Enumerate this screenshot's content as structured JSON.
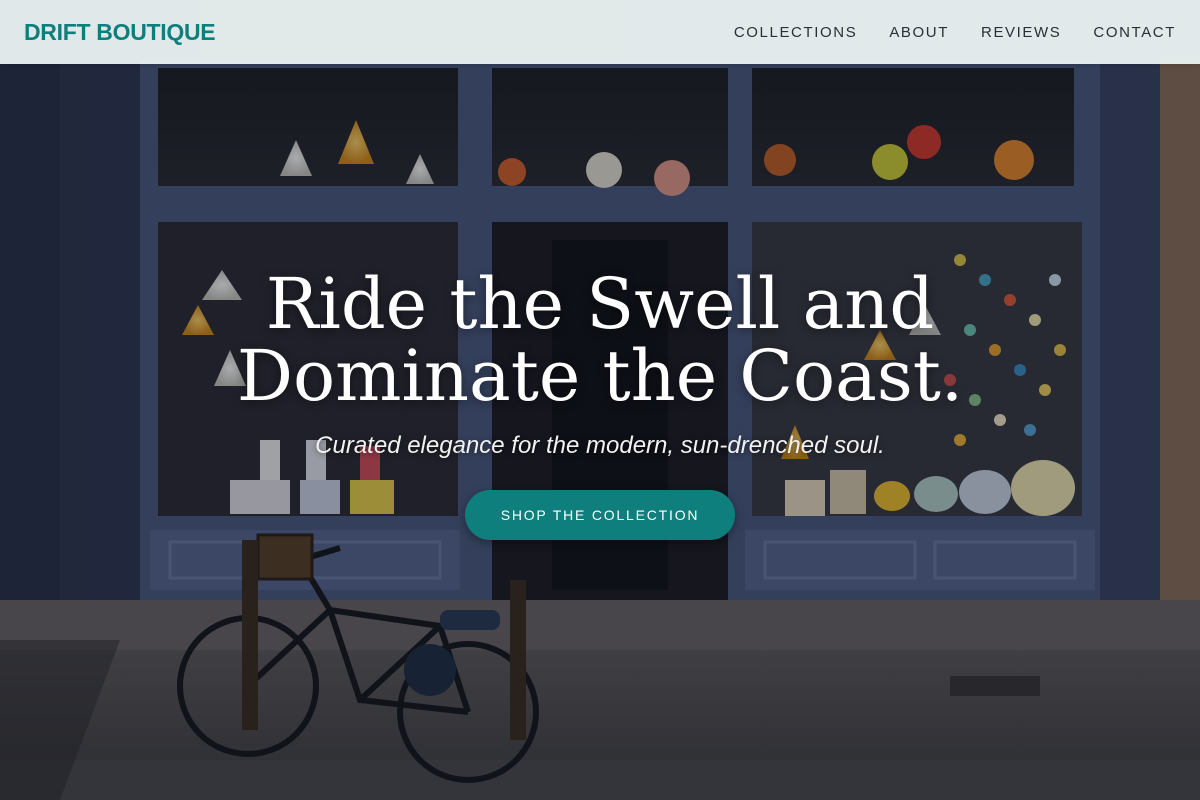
{
  "header": {
    "brand": "DRIFT BOUTIQUE",
    "nav": [
      {
        "label": "COLLECTIONS"
      },
      {
        "label": "ABOUT"
      },
      {
        "label": "REVIEWS"
      },
      {
        "label": "CONTACT"
      }
    ]
  },
  "hero": {
    "headline_line1": "Ride the Swell and",
    "headline_line2": "Dominate the Coast.",
    "subtitle": "Curated elegance for the modern, sun-drenched soul.",
    "cta_label": "SHOP THE COLLECTION",
    "background_image": "storefront with blue window frames, hanging lamps and a parked bicycle on cobblestones"
  },
  "colors": {
    "brand_teal": "#0e7f7c",
    "header_bg": "#f0f8f6",
    "nav_text": "#2a2f38",
    "headline_text": "#ffffff"
  }
}
